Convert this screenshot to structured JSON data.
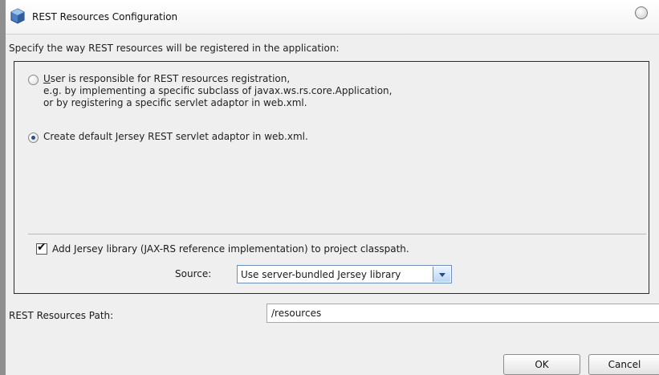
{
  "window": {
    "title": "REST Resources Configuration",
    "icon": "netbeans-cube-icon",
    "help_icon": "help-circle-icon"
  },
  "intro_text": "Specify the way REST resources will be registered in the application:",
  "options": {
    "user_registration": {
      "selected": false,
      "mnemonic": "U",
      "line1_rest": "ser is responsible for REST resources registration,",
      "line2": "e.g. by implementing a specific subclass of javax.ws.rs.core.Application,",
      "line3": "or by registering a specific servlet adaptor in web.xml."
    },
    "default_adaptor": {
      "selected": true,
      "label": "Create default Jersey REST servlet adaptor in web.xml."
    }
  },
  "jersey_library": {
    "checked": true,
    "label": "Add Jersey library (JAX-RS reference implementation) to project classpath.",
    "source_label": "Source:",
    "source_value": "Use server-bundled Jersey library"
  },
  "resources_path": {
    "label": "REST Resources Path:",
    "value": "/resources"
  },
  "buttons": {
    "ok": "OK",
    "cancel": "Cancel"
  }
}
